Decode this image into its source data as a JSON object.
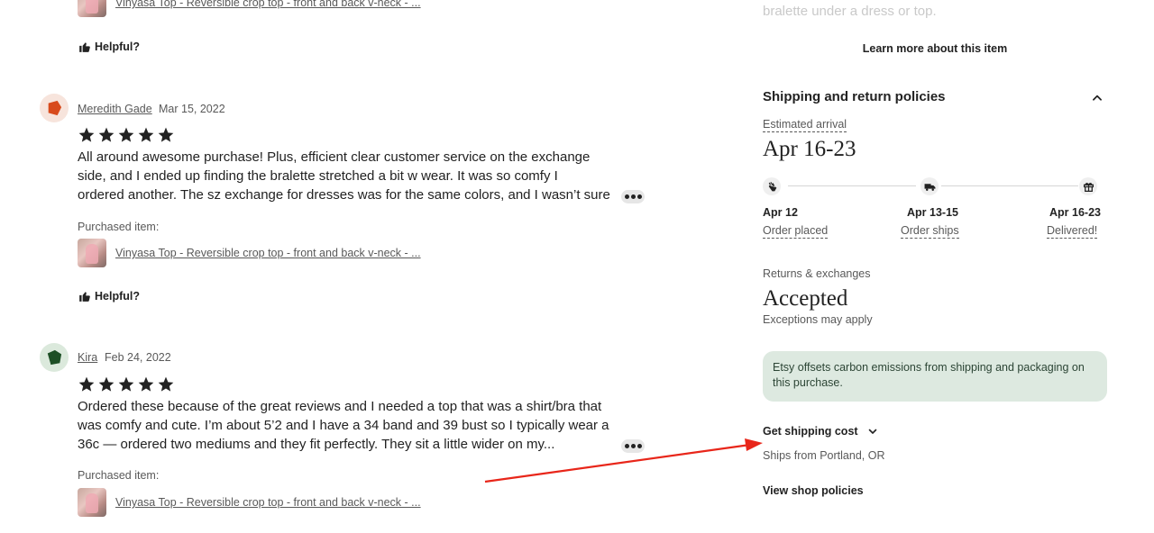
{
  "reviews_partial_top": {
    "item_link": "Vinyasa Top - Reversible crop top - front and back v-neck - ...",
    "helpful_label": "Helpful?"
  },
  "reviews": [
    {
      "name": "Meredith Gade",
      "date": "Mar 15, 2022",
      "rating": 5,
      "avatar_color": "#d84a1c",
      "avatar_bg": "#f7e4dc",
      "lines": [
        "All around awesome purchase! Plus, efficient clear customer service on the exchange",
        "side, and I ended up finding the bralette stretched a bit w wear. It was so comfy I",
        "ordered another. The sz exchange for dresses was for the same colors, and I wasn’t sure"
      ],
      "purchased_label": "Purchased item:",
      "item_link": "Vinyasa Top - Reversible crop top - front and back v-neck - ...",
      "helpful_label": "Helpful?"
    },
    {
      "name": "Kira",
      "date": "Feb 24, 2022",
      "rating": 5,
      "avatar_color": "#1d4f25",
      "avatar_bg": "#dbe9dc",
      "lines": [
        "Ordered these because of the great reviews and I needed a top that was a shirt/bra that",
        "was comfy and cute. I’m about 5’2 and I have a 34 band and 39 bust so I typically wear a",
        "36c — ordered two mediums and they fit perfectly. They sit a little wider on my..."
      ],
      "purchased_label": "Purchased item:",
      "item_link": "Vinyasa Top - Reversible crop top - front and back v-neck - ..."
    }
  ],
  "sidebar": {
    "faded_text": "bralette under a dress or top.",
    "learn_more": "Learn more about this item",
    "shipping": {
      "title": "Shipping and return policies",
      "estimated_label": "Estimated arrival",
      "estimated_value": "Apr 16-23",
      "timeline": [
        {
          "date": "Apr 12",
          "label": "Order placed",
          "icon": "hand-wave-icon"
        },
        {
          "date": "Apr 13-15",
          "label": "Order ships",
          "icon": "delivery-truck-icon"
        },
        {
          "date": "Apr 16-23",
          "label": "Delivered!",
          "icon": "gift-icon"
        }
      ],
      "returns_label": "Returns & exchanges",
      "returns_value": "Accepted",
      "returns_note": "Exceptions may apply",
      "carbon_note": "Etsy offsets carbon emissions from shipping and packaging on this purchase.",
      "get_shipping_cost": "Get shipping cost",
      "ships_from": "Ships from Portland, OR",
      "view_shop_policies": "View shop policies"
    }
  },
  "annotation": {
    "type": "arrow",
    "color": "#e8261a"
  }
}
